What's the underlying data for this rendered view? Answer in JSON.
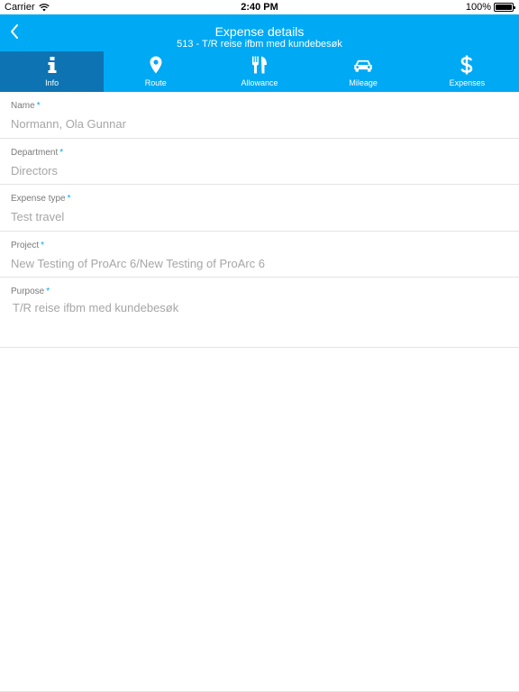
{
  "status_bar": {
    "carrier": "Carrier",
    "time": "2:40 PM",
    "battery": "100%"
  },
  "header": {
    "title": "Expense details",
    "subtitle": "513 - T/R reise ifbm med kundebesøk",
    "accent_color": "#00a9f4",
    "active_tab_color": "#0d73b2"
  },
  "tabs": [
    {
      "label": "Info",
      "icon": "info-icon",
      "active": true
    },
    {
      "label": "Route",
      "icon": "map-pin-icon",
      "active": false
    },
    {
      "label": "Allowance",
      "icon": "fork-knife-icon",
      "active": false
    },
    {
      "label": "Mileage",
      "icon": "car-icon",
      "active": false
    },
    {
      "label": "Expenses",
      "icon": "dollar-icon",
      "active": false
    }
  ],
  "form": {
    "name": {
      "label": "Name",
      "required": "*",
      "value": "Normann, Ola Gunnar"
    },
    "department": {
      "label": "Department",
      "required": "*",
      "value": "Directors"
    },
    "expense_type": {
      "label": "Expense type",
      "required": "*",
      "value": "Test travel"
    },
    "project": {
      "label": "Project",
      "required": "*",
      "value": "New Testing of ProArc 6/New Testing of ProArc 6"
    },
    "purpose": {
      "label": "Purpose",
      "required": "*",
      "value": "T/R reise ifbm med kundebesøk"
    }
  }
}
